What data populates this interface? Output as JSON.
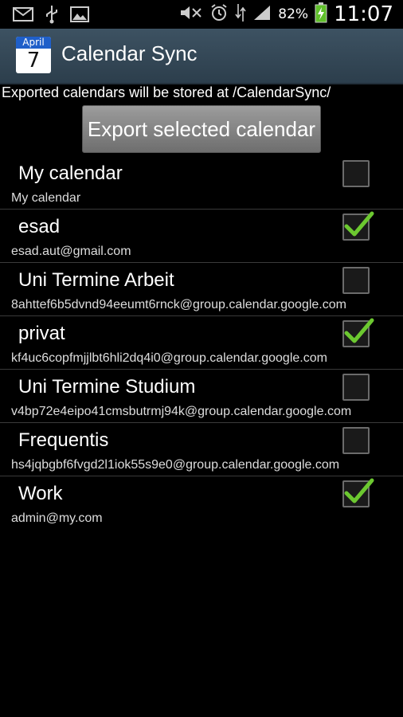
{
  "status_bar": {
    "battery_pct": "82%",
    "time": "11:07"
  },
  "app": {
    "title": "Calendar Sync",
    "icon_month": "April",
    "icon_day": "7"
  },
  "info_text": "Exported calendars will be stored at /CalendarSync/",
  "export_button": "Export selected calendar",
  "accent_check": "#6cc830",
  "calendars": [
    {
      "name": "My calendar",
      "account": "My calendar",
      "checked": false
    },
    {
      "name": "esad",
      "account": "esad.aut@gmail.com",
      "checked": true
    },
    {
      "name": "Uni Termine Arbeit",
      "account": "8ahttef6b5dvnd94eeumt6rnck@group.calendar.google.com",
      "checked": false
    },
    {
      "name": "privat",
      "account": "kf4uc6copfmjjlbt6hli2dq4i0@group.calendar.google.com",
      "checked": true
    },
    {
      "name": "Uni Termine Studium",
      "account": "v4bp72e4eipo41cmsbutrmj94k@group.calendar.google.com",
      "checked": false
    },
    {
      "name": "Frequentis",
      "account": "hs4jqbgbf6fvgd2l1iok55s9e0@group.calendar.google.com",
      "checked": false
    },
    {
      "name": "Work",
      "account": "admin@my.com",
      "checked": true
    }
  ]
}
